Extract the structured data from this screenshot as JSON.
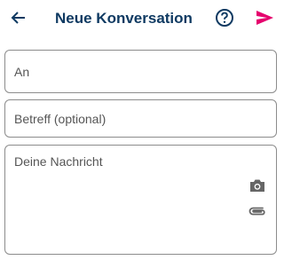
{
  "header": {
    "title": "Neue Konversation",
    "back_icon": "arrow-left-icon",
    "help_icon": "help-circle-icon",
    "send_icon": "send-icon"
  },
  "form": {
    "to_placeholder": "An",
    "to_value": "",
    "subject_placeholder": "Betreff (optional)",
    "subject_value": "",
    "message_placeholder": "Deine Nachricht",
    "message_value": "",
    "camera_icon": "camera-icon",
    "attachment_icon": "paperclip-icon"
  },
  "colors": {
    "title": "#0f3a62",
    "send_accent": "#e5006d",
    "icon_gray": "#666666",
    "border": "#8c8c8c"
  }
}
